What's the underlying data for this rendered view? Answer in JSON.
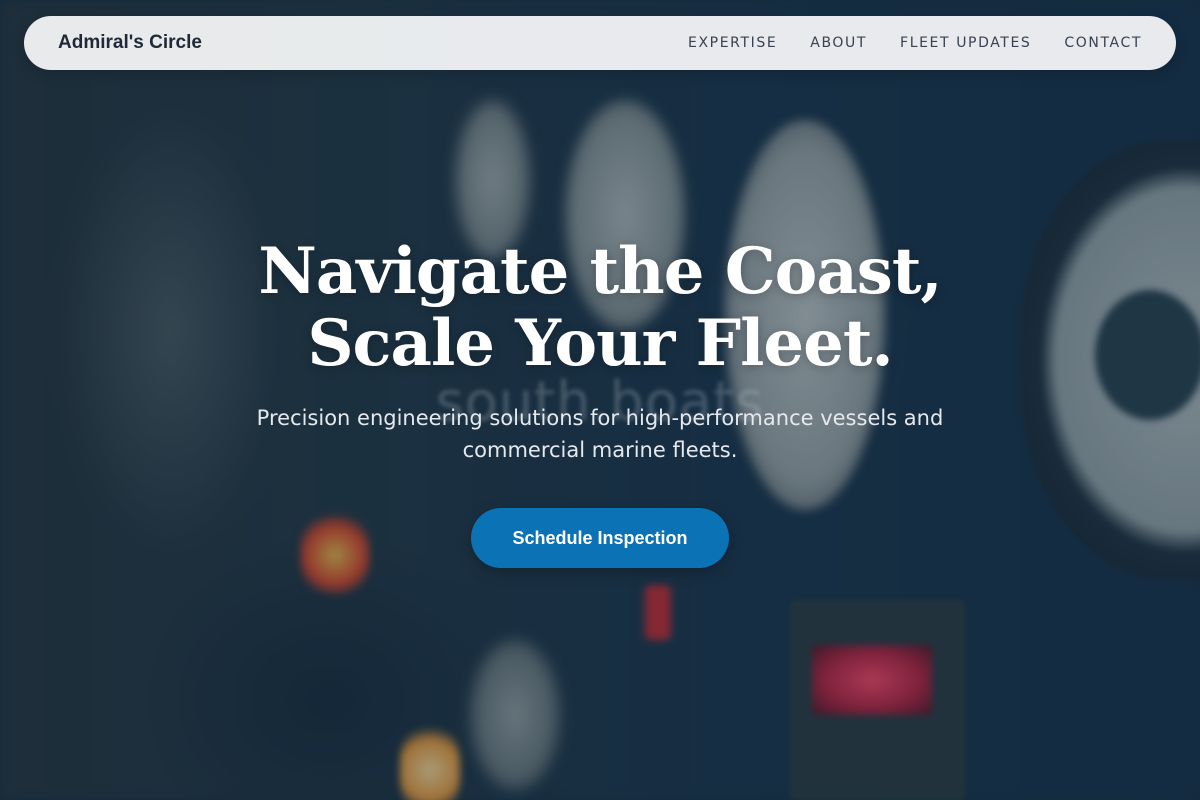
{
  "nav": {
    "brand": "Admiral's Circle",
    "links": [
      "EXPERTISE",
      "ABOUT",
      "FLEET UPDATES",
      "CONTACT"
    ]
  },
  "hero": {
    "headline_line1": "Navigate the Coast,",
    "headline_line2": "Scale Your Fleet.",
    "subtitle": "Precision engineering solutions for high-performance vessels and commercial marine fleets.",
    "cta_label": "Schedule Inspection",
    "watermark": "south.boats"
  },
  "colors": {
    "nav_background": "#f5f6f8",
    "brand_text": "#1f2937",
    "cta_background": "#0b72b5",
    "hero_overlay": "#0a1928"
  }
}
